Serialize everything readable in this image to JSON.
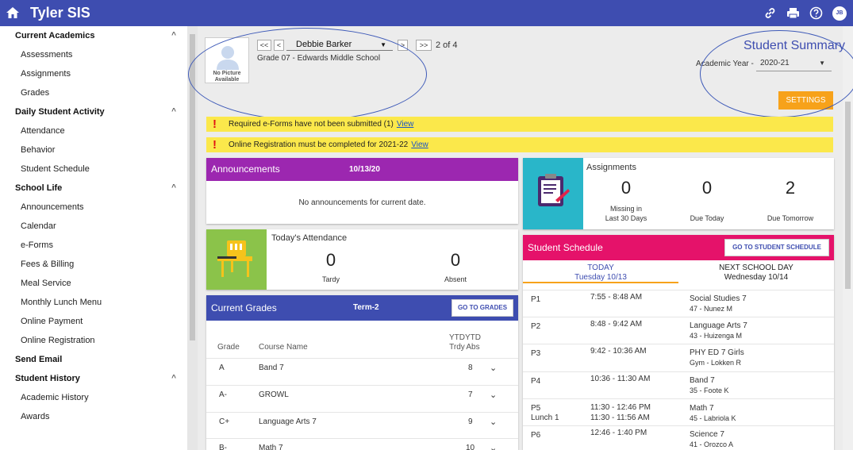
{
  "header": {
    "title": "Tyler SIS",
    "avatar_initials": "JB"
  },
  "sidebar": {
    "groups": [
      {
        "title": "Current Academics",
        "items": [
          "Assessments",
          "Assignments",
          "Grades"
        ]
      },
      {
        "title": "Daily Student Activity",
        "items": [
          "Attendance",
          "Behavior",
          "Student Schedule"
        ]
      },
      {
        "title": "School Life",
        "items": [
          "Announcements",
          "Calendar",
          "e-Forms",
          "Fees & Billing",
          "Meal Service",
          "Monthly Lunch Menu",
          "Online Payment",
          "Online Registration"
        ]
      },
      {
        "title": "Send Email",
        "items": []
      },
      {
        "title": "Student History",
        "items": [
          "Academic History",
          "Awards"
        ]
      }
    ]
  },
  "student": {
    "photo_label_1": "No Picture",
    "photo_label_2": "Available",
    "nav_first": "<<",
    "nav_prev": "<",
    "nav_next": ">",
    "nav_last": ">>",
    "name": "Debbie Barker",
    "position": "2 of 4",
    "grade_school": "Grade 07 - Edwards Middle School"
  },
  "summary": {
    "title": "Student Summary",
    "year_label": "Academic Year -",
    "year_value": "2020-21",
    "settings_label": "SETTINGS"
  },
  "alerts": [
    {
      "text": "Required e-Forms have not been submitted (1)",
      "link": "View"
    },
    {
      "text": "Online Registration must be completed for 2021-22",
      "link": "View"
    }
  ],
  "announcements": {
    "title": "Announcements",
    "date": "10/13/20",
    "empty": "No announcements for current date."
  },
  "assignments": {
    "title": "Assignments",
    "stats": [
      {
        "value": "0",
        "label1": "Missing in",
        "label2": "Last 30 Days"
      },
      {
        "value": "0",
        "label1": "Due Today",
        "label2": ""
      },
      {
        "value": "2",
        "label1": "Due Tomorrow",
        "label2": ""
      }
    ]
  },
  "attendance": {
    "title": "Today's Attendance",
    "stats": [
      {
        "value": "0",
        "label": "Tardy"
      },
      {
        "value": "0",
        "label": "Absent"
      }
    ]
  },
  "grades": {
    "title": "Current Grades",
    "term": "Term-2",
    "button": "GO TO GRADES",
    "col_grade": "Grade",
    "col_course": "Course Name",
    "col_ytd1_a": "YTD",
    "col_ytd1_b": "Trdy",
    "col_ytd2_a": "YTD",
    "col_ytd2_b": "Abs",
    "rows": [
      {
        "grade": "A",
        "course": "Band 7",
        "abs": "8"
      },
      {
        "grade": "A-",
        "course": "GROWL",
        "abs": "7"
      },
      {
        "grade": "C+",
        "course": "Language Arts 7",
        "abs": "9"
      },
      {
        "grade": "B-",
        "course": "Math 7",
        "abs": "10"
      }
    ]
  },
  "schedule": {
    "title": "Student Schedule",
    "button": "GO TO STUDENT SCHEDULE",
    "today_label": "TODAY",
    "today_date": "Tuesday 10/13",
    "next_label": "NEXT SCHOOL DAY",
    "next_date": "Wednesday 10/14",
    "rows": [
      {
        "period": "P1",
        "period2": "",
        "time": "7:55 - 8:48 AM",
        "time2": "",
        "course": "Social Studies 7",
        "room": "47 - Nunez M"
      },
      {
        "period": "P2",
        "period2": "",
        "time": "8:48 - 9:42 AM",
        "time2": "",
        "course": "Language Arts 7",
        "room": "43 - Huizenga M"
      },
      {
        "period": "P3",
        "period2": "",
        "time": "9:42 - 10:36 AM",
        "time2": "",
        "course": "PHY ED 7 Girls",
        "room": "Gym - Lokken R"
      },
      {
        "period": "P4",
        "period2": "",
        "time": "10:36 - 11:30 AM",
        "time2": "",
        "course": "Band 7",
        "room": "35 - Foote K"
      },
      {
        "period": "P5",
        "period2": "Lunch 1",
        "time": "11:30 - 12:46 PM",
        "time2": "11:30 - 11:56 AM",
        "course": "Math 7",
        "room": "45 - Labriola K"
      },
      {
        "period": "P6",
        "period2": "",
        "time": "12:46 - 1:40 PM",
        "time2": "",
        "course": "Science 7",
        "room": "41 - Orozco A"
      }
    ]
  },
  "colors": {
    "brand": "#3e4db0",
    "announcements": "#9c27b0",
    "schedule": "#e5126a",
    "attendance_icon_bg": "#8bc34a",
    "assignments_icon_bg": "#29b6c9",
    "settings": "#f7a21a",
    "alert": "#fbe84b"
  }
}
